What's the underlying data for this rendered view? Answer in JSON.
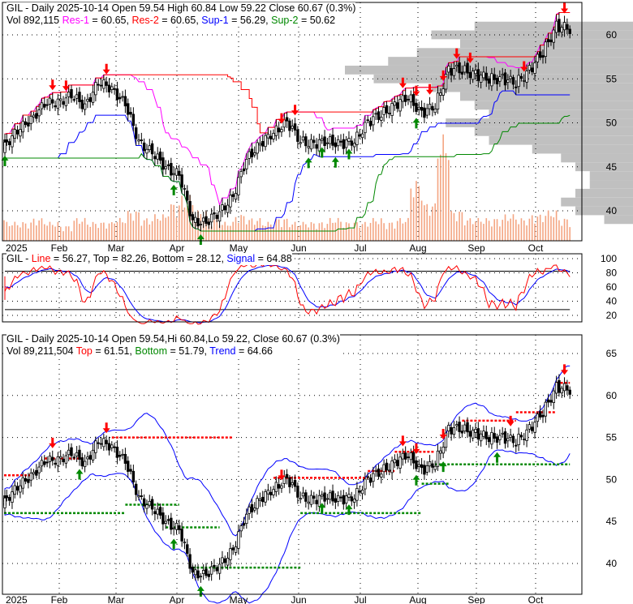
{
  "ticker": "GIL",
  "panel1": {
    "line1": "GIL - Daily 2025-10-14 Open 59.54  High 60.84  Low 59.22  Close 60.67 (0.3%)",
    "vol": "Vol 892,115",
    "res1_label": "Res-1",
    "res1": "= 60.65,",
    "res2_label": "Res-2",
    "res2": "= 60.65,",
    "sup1_label": "Sup-1",
    "sup1": "= 56.29,",
    "sup2_label": "Sup-2",
    "sup2": "= 50.62"
  },
  "panel2": {
    "prefix": "GIL - ",
    "line_label": "Line",
    "line": "= 56.27, Top = 82.26, Bottom = 28.12,",
    "signal_label": "Signal",
    "signal": "= 64.88"
  },
  "panel3": {
    "line1": "GIL - Daily 2025-10-14 Open 59.54,Hi 60.84,Lo 59.22, Close 60.67 (0.3%)",
    "vol": "Vol 89,211,504",
    "top_label": "Top",
    "top": "= 61.51,",
    "bottom_label": "Bottom",
    "bottom": "= 51.79,",
    "trend_label": "Trend",
    "trend": "= 64.66"
  },
  "colors": {
    "up": "#000000",
    "res1": "#ff00ff",
    "res2": "#ff0000",
    "sup1": "#0000ff",
    "sup2": "#008800",
    "volume": "#f4a582",
    "profile": "#c0c0c0"
  },
  "chart_data": [
    {
      "type": "candlestick",
      "title": "GIL - Daily 2025-10-14",
      "x_tick_labels": [
        "2025",
        "Feb",
        "Mar",
        "Apr",
        "May",
        "Jun",
        "Jul",
        "Aug",
        "Sep",
        "Oct"
      ],
      "y_ticks": [
        40,
        45,
        50,
        55,
        60
      ],
      "weekly_close": [
        47.5,
        49,
        50.5,
        52,
        52.5,
        53,
        52,
        54.5,
        54,
        52,
        48,
        46.5,
        45,
        44,
        39,
        38.5,
        40,
        41.5,
        46,
        47.5,
        49,
        50,
        48,
        47.5,
        48,
        47.5,
        48,
        50,
        51,
        52,
        53,
        51,
        52,
        56,
        56,
        55.5,
        55,
        55,
        54.5,
        56,
        58,
        61,
        60.7
      ],
      "weekly_volume_m": [
        3,
        2.5,
        2.5,
        3,
        2.5,
        2,
        3,
        2.5,
        2.5,
        3,
        4,
        3,
        3.5,
        5,
        6,
        4,
        3,
        2.5,
        3.5,
        3,
        2.5,
        3,
        2.5,
        2.5,
        2.5,
        3,
        2.5,
        2.5,
        3,
        2.5,
        3,
        8,
        5,
        14,
        4,
        3,
        3,
        3,
        3.5,
        3,
        3.5,
        4,
        3
      ],
      "volume_profile": [
        {
          "price": 61,
          "vol": 0.55
        },
        {
          "price": 60,
          "vol": 0.7
        },
        {
          "price": 59,
          "vol": 0.6
        },
        {
          "price": 58,
          "vol": 0.75
        },
        {
          "price": 57,
          "vol": 0.85
        },
        {
          "price": 56,
          "vol": 1.0
        },
        {
          "price": 55,
          "vol": 0.9
        },
        {
          "price": 54,
          "vol": 0.7
        },
        {
          "price": 53,
          "vol": 0.6
        },
        {
          "price": 52,
          "vol": 0.55
        },
        {
          "price": 51,
          "vol": 0.5
        },
        {
          "price": 50,
          "vol": 0.65
        },
        {
          "price": 49,
          "vol": 0.55
        },
        {
          "price": 48,
          "vol": 0.5
        },
        {
          "price": 47,
          "vol": 0.35
        },
        {
          "price": 46,
          "vol": 0.25
        },
        {
          "price": 45,
          "vol": 0.2
        },
        {
          "price": 44,
          "vol": 0.15
        },
        {
          "price": 43,
          "vol": 0.15
        },
        {
          "price": 42,
          "vol": 0.2
        },
        {
          "price": 41,
          "vol": 0.25
        },
        {
          "price": 40,
          "vol": 0.2
        },
        {
          "price": 39,
          "vol": 0.1
        }
      ],
      "sell_signal_weeks": [
        4,
        5,
        8,
        21,
        22,
        30,
        31,
        32,
        33,
        34,
        35,
        39,
        42
      ],
      "buy_signal_weeks": [
        0,
        13,
        15,
        23,
        24,
        25,
        26,
        31
      ]
    },
    {
      "type": "line",
      "series": [
        "Line",
        "Signal",
        "Top",
        "Bottom"
      ],
      "y_ticks": [
        20,
        40,
        60,
        80,
        100
      ],
      "top": 82.26,
      "bottom": 28.12
    },
    {
      "type": "candlestick",
      "y_ticks": [
        40,
        45,
        50,
        55,
        60,
        65
      ],
      "x_tick_labels": [
        "2025",
        "Feb",
        "Mar",
        "Apr",
        "May",
        "Jun",
        "Jul",
        "Aug",
        "Sep",
        "Oct"
      ],
      "resistance_segments": [
        [
          0,
          2,
          50.5
        ],
        [
          3,
          6,
          52.5
        ],
        [
          8,
          17,
          55
        ],
        [
          20,
          27,
          50.2
        ],
        [
          27,
          29,
          51
        ],
        [
          29,
          32,
          53.3
        ],
        [
          34,
          38,
          57
        ],
        [
          38,
          41,
          58
        ],
        [
          41,
          42,
          61.5
        ]
      ],
      "support_segments": [
        [
          0,
          9,
          46
        ],
        [
          9,
          13,
          47
        ],
        [
          12,
          16,
          44.3
        ],
        [
          14,
          22,
          39.5
        ],
        [
          22,
          31,
          46
        ],
        [
          31,
          33,
          49.5
        ],
        [
          32,
          42,
          51.8
        ]
      ],
      "sell_signal_weeks": [
        4,
        8,
        21,
        30,
        31,
        33,
        38,
        42
      ],
      "buy_signal_weeks": [
        6,
        13,
        15,
        24,
        26,
        31,
        33,
        37
      ]
    }
  ]
}
